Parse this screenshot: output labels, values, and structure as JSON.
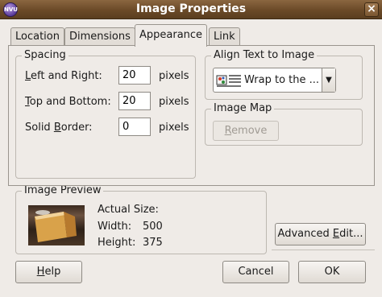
{
  "window": {
    "title": "Image Properties",
    "app_icon_text": "NVU",
    "close_glyph": "×"
  },
  "tabs": [
    {
      "label": "Location",
      "active": false
    },
    {
      "label": "Dimensions",
      "active": false
    },
    {
      "label": "Appearance",
      "active": true
    },
    {
      "label": "Link",
      "active": false
    }
  ],
  "spacing": {
    "legend": "Spacing",
    "left_right": {
      "mnemonic": "L",
      "rest": "eft and Right:",
      "value": "20",
      "unit": "pixels"
    },
    "top_bottom": {
      "mnemonic": "T",
      "rest": "op and Bottom:",
      "value": "20",
      "unit": "pixels"
    },
    "border": {
      "before": "Solid ",
      "mnemonic": "B",
      "rest": "order:",
      "value": "0",
      "unit": "pixels"
    }
  },
  "align": {
    "legend": "Align Text to Image",
    "selected": "Wrap to the ...",
    "arrow": "▼"
  },
  "image_map": {
    "legend": "Image Map",
    "remove_mnemonic": "R",
    "remove_rest": "emove"
  },
  "preview": {
    "legend": "Image Preview",
    "actual_size_label": "Actual Size:",
    "width_label": "Width:",
    "width_value": "500",
    "height_label": "Height:",
    "height_value": "375"
  },
  "buttons": {
    "advanced_before": "Advanced ",
    "advanced_mnemonic": "E",
    "advanced_rest": "dit...",
    "help_mnemonic": "H",
    "help_rest": "elp",
    "cancel": "Cancel",
    "ok": "OK"
  }
}
